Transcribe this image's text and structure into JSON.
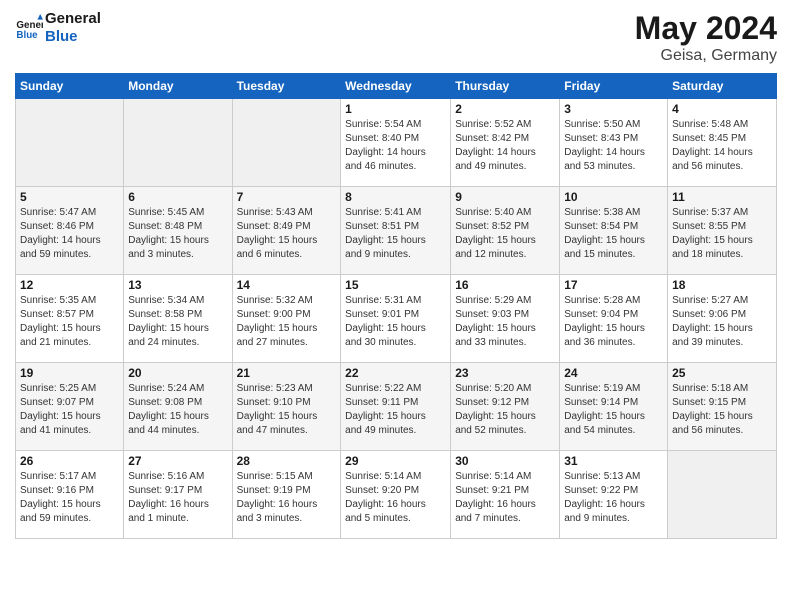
{
  "header": {
    "logo_line1": "General",
    "logo_line2": "Blue",
    "title": "May 2024",
    "subtitle": "Geisa, Germany"
  },
  "weekdays": [
    "Sunday",
    "Monday",
    "Tuesday",
    "Wednesday",
    "Thursday",
    "Friday",
    "Saturday"
  ],
  "weeks": [
    [
      {
        "day": "",
        "info": ""
      },
      {
        "day": "",
        "info": ""
      },
      {
        "day": "",
        "info": ""
      },
      {
        "day": "1",
        "info": "Sunrise: 5:54 AM\nSunset: 8:40 PM\nDaylight: 14 hours\nand 46 minutes."
      },
      {
        "day": "2",
        "info": "Sunrise: 5:52 AM\nSunset: 8:42 PM\nDaylight: 14 hours\nand 49 minutes."
      },
      {
        "day": "3",
        "info": "Sunrise: 5:50 AM\nSunset: 8:43 PM\nDaylight: 14 hours\nand 53 minutes."
      },
      {
        "day": "4",
        "info": "Sunrise: 5:48 AM\nSunset: 8:45 PM\nDaylight: 14 hours\nand 56 minutes."
      }
    ],
    [
      {
        "day": "5",
        "info": "Sunrise: 5:47 AM\nSunset: 8:46 PM\nDaylight: 14 hours\nand 59 minutes."
      },
      {
        "day": "6",
        "info": "Sunrise: 5:45 AM\nSunset: 8:48 PM\nDaylight: 15 hours\nand 3 minutes."
      },
      {
        "day": "7",
        "info": "Sunrise: 5:43 AM\nSunset: 8:49 PM\nDaylight: 15 hours\nand 6 minutes."
      },
      {
        "day": "8",
        "info": "Sunrise: 5:41 AM\nSunset: 8:51 PM\nDaylight: 15 hours\nand 9 minutes."
      },
      {
        "day": "9",
        "info": "Sunrise: 5:40 AM\nSunset: 8:52 PM\nDaylight: 15 hours\nand 12 minutes."
      },
      {
        "day": "10",
        "info": "Sunrise: 5:38 AM\nSunset: 8:54 PM\nDaylight: 15 hours\nand 15 minutes."
      },
      {
        "day": "11",
        "info": "Sunrise: 5:37 AM\nSunset: 8:55 PM\nDaylight: 15 hours\nand 18 minutes."
      }
    ],
    [
      {
        "day": "12",
        "info": "Sunrise: 5:35 AM\nSunset: 8:57 PM\nDaylight: 15 hours\nand 21 minutes."
      },
      {
        "day": "13",
        "info": "Sunrise: 5:34 AM\nSunset: 8:58 PM\nDaylight: 15 hours\nand 24 minutes."
      },
      {
        "day": "14",
        "info": "Sunrise: 5:32 AM\nSunset: 9:00 PM\nDaylight: 15 hours\nand 27 minutes."
      },
      {
        "day": "15",
        "info": "Sunrise: 5:31 AM\nSunset: 9:01 PM\nDaylight: 15 hours\nand 30 minutes."
      },
      {
        "day": "16",
        "info": "Sunrise: 5:29 AM\nSunset: 9:03 PM\nDaylight: 15 hours\nand 33 minutes."
      },
      {
        "day": "17",
        "info": "Sunrise: 5:28 AM\nSunset: 9:04 PM\nDaylight: 15 hours\nand 36 minutes."
      },
      {
        "day": "18",
        "info": "Sunrise: 5:27 AM\nSunset: 9:06 PM\nDaylight: 15 hours\nand 39 minutes."
      }
    ],
    [
      {
        "day": "19",
        "info": "Sunrise: 5:25 AM\nSunset: 9:07 PM\nDaylight: 15 hours\nand 41 minutes."
      },
      {
        "day": "20",
        "info": "Sunrise: 5:24 AM\nSunset: 9:08 PM\nDaylight: 15 hours\nand 44 minutes."
      },
      {
        "day": "21",
        "info": "Sunrise: 5:23 AM\nSunset: 9:10 PM\nDaylight: 15 hours\nand 47 minutes."
      },
      {
        "day": "22",
        "info": "Sunrise: 5:22 AM\nSunset: 9:11 PM\nDaylight: 15 hours\nand 49 minutes."
      },
      {
        "day": "23",
        "info": "Sunrise: 5:20 AM\nSunset: 9:12 PM\nDaylight: 15 hours\nand 52 minutes."
      },
      {
        "day": "24",
        "info": "Sunrise: 5:19 AM\nSunset: 9:14 PM\nDaylight: 15 hours\nand 54 minutes."
      },
      {
        "day": "25",
        "info": "Sunrise: 5:18 AM\nSunset: 9:15 PM\nDaylight: 15 hours\nand 56 minutes."
      }
    ],
    [
      {
        "day": "26",
        "info": "Sunrise: 5:17 AM\nSunset: 9:16 PM\nDaylight: 15 hours\nand 59 minutes."
      },
      {
        "day": "27",
        "info": "Sunrise: 5:16 AM\nSunset: 9:17 PM\nDaylight: 16 hours\nand 1 minute."
      },
      {
        "day": "28",
        "info": "Sunrise: 5:15 AM\nSunset: 9:19 PM\nDaylight: 16 hours\nand 3 minutes."
      },
      {
        "day": "29",
        "info": "Sunrise: 5:14 AM\nSunset: 9:20 PM\nDaylight: 16 hours\nand 5 minutes."
      },
      {
        "day": "30",
        "info": "Sunrise: 5:14 AM\nSunset: 9:21 PM\nDaylight: 16 hours\nand 7 minutes."
      },
      {
        "day": "31",
        "info": "Sunrise: 5:13 AM\nSunset: 9:22 PM\nDaylight: 16 hours\nand 9 minutes."
      },
      {
        "day": "",
        "info": ""
      }
    ]
  ]
}
